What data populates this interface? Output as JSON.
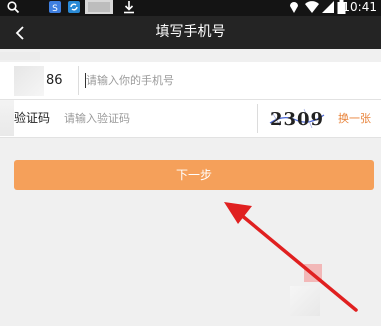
{
  "status_bar": {
    "time": "10:41",
    "icons": [
      "search-icon",
      "app-notification-icon",
      "sync-icon",
      "image-icon",
      "download-icon",
      "location-icon",
      "wifi-icon",
      "signal-icon",
      "battery-icon"
    ]
  },
  "app_bar": {
    "title": "填写手机号",
    "back_icon": "chevron-left-icon"
  },
  "phone_row": {
    "country_code": "86",
    "input_placeholder": "请输入你的手机号",
    "input_value": ""
  },
  "captcha_row": {
    "label": "验证码",
    "input_placeholder": "请输入验证码",
    "input_value": "",
    "captcha_text": "2309",
    "refresh_label": "换一张"
  },
  "next_button": {
    "label": "下一步"
  },
  "colors": {
    "accent": "#f5a05a",
    "link": "#e8833a",
    "appbar": "#242424",
    "statusbar": "#141414",
    "annotation_arrow": "#e02020"
  }
}
